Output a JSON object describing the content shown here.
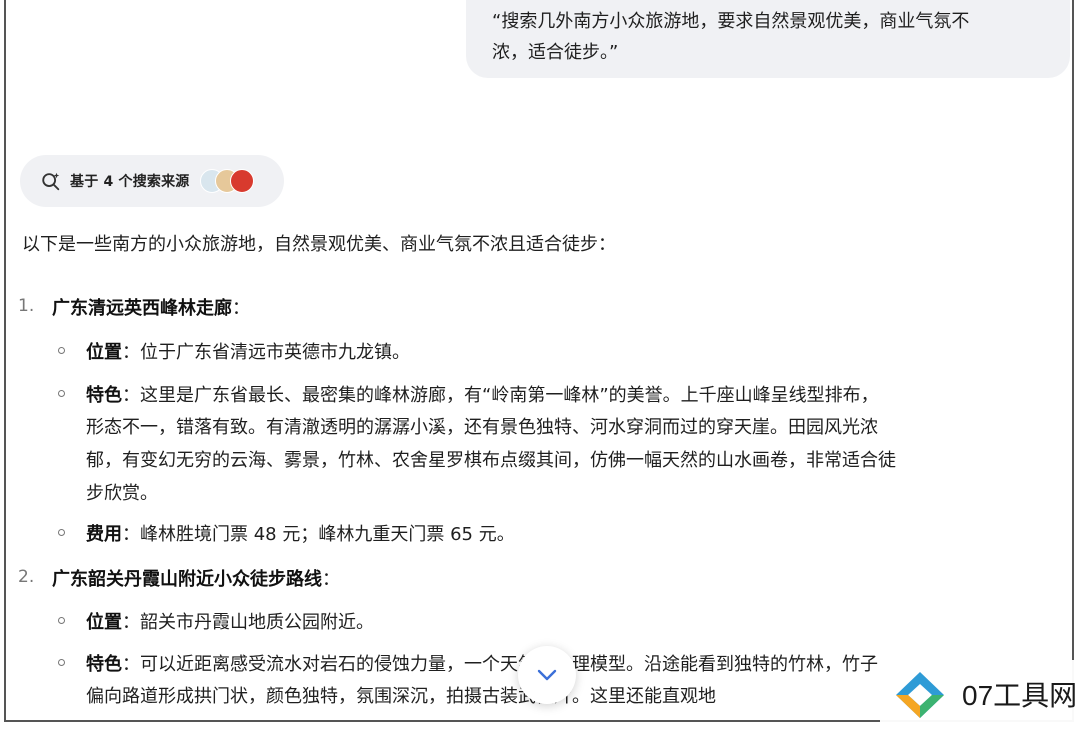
{
  "user_message": {
    "line1": "“搜索几外南方小众旅游地，要求自然景观优美，商业气氛不",
    "line2": "浓，适合徒步。”"
  },
  "sources": {
    "label": "基于 4 个搜索来源"
  },
  "answer": {
    "intro": "以下是一些南方的小众旅游地，自然景观优美、商业气氛不浓且适合徒步：",
    "items": [
      {
        "num": "1.",
        "title": "广东清远英西峰林走廊",
        "colon": "：",
        "location_label": "位置",
        "location_text": "：位于广东省清远市英德市九龙镇。",
        "feature_label": "特色",
        "feature_lines": [
          "：这里是广东省最长、最密集的峰林游廊，有“岭南第一峰林”的美誉。上千座山峰呈线型排布，",
          "形态不一，错落有致。有清澈透明的潺潺小溪，还有景色独特、河水穿洞而过的穿天崖。田园风光浓",
          "郁，有变幻无穷的云海、雾景，竹林、农舍星罗棋布点缀其间，仿佛一幅天然的山水画卷，非常适合徒",
          "步欣赏。"
        ],
        "cost_label": "费用",
        "cost_text": "：峰林胜境门票 48 元；峰林九重天门票 65 元。"
      },
      {
        "num": "2.",
        "title": "广东韶关丹霞山附近小众徒步路线",
        "colon": "：",
        "location_label": "位置",
        "location_text": "：韶关市丹霞山地质公园附近。",
        "feature_label": "特色",
        "feature_lines": [
          "：可以近距离感受流水对岩石的侵蚀力量，一个天然的地理模型。沿途能看到独特的竹林，竹子",
          "偏向路道形成拱门状，颜色独特，氛围深沉，拍摄古装武侠片。这里还能直观地"
        ]
      }
    ]
  },
  "watermark": {
    "text": "07工具网",
    "colors": [
      "#2e9bd6",
      "#f5a623",
      "#3cb371"
    ]
  },
  "icons": {
    "sources": "search-spark-icon",
    "scroll": "chevron-down-icon"
  }
}
